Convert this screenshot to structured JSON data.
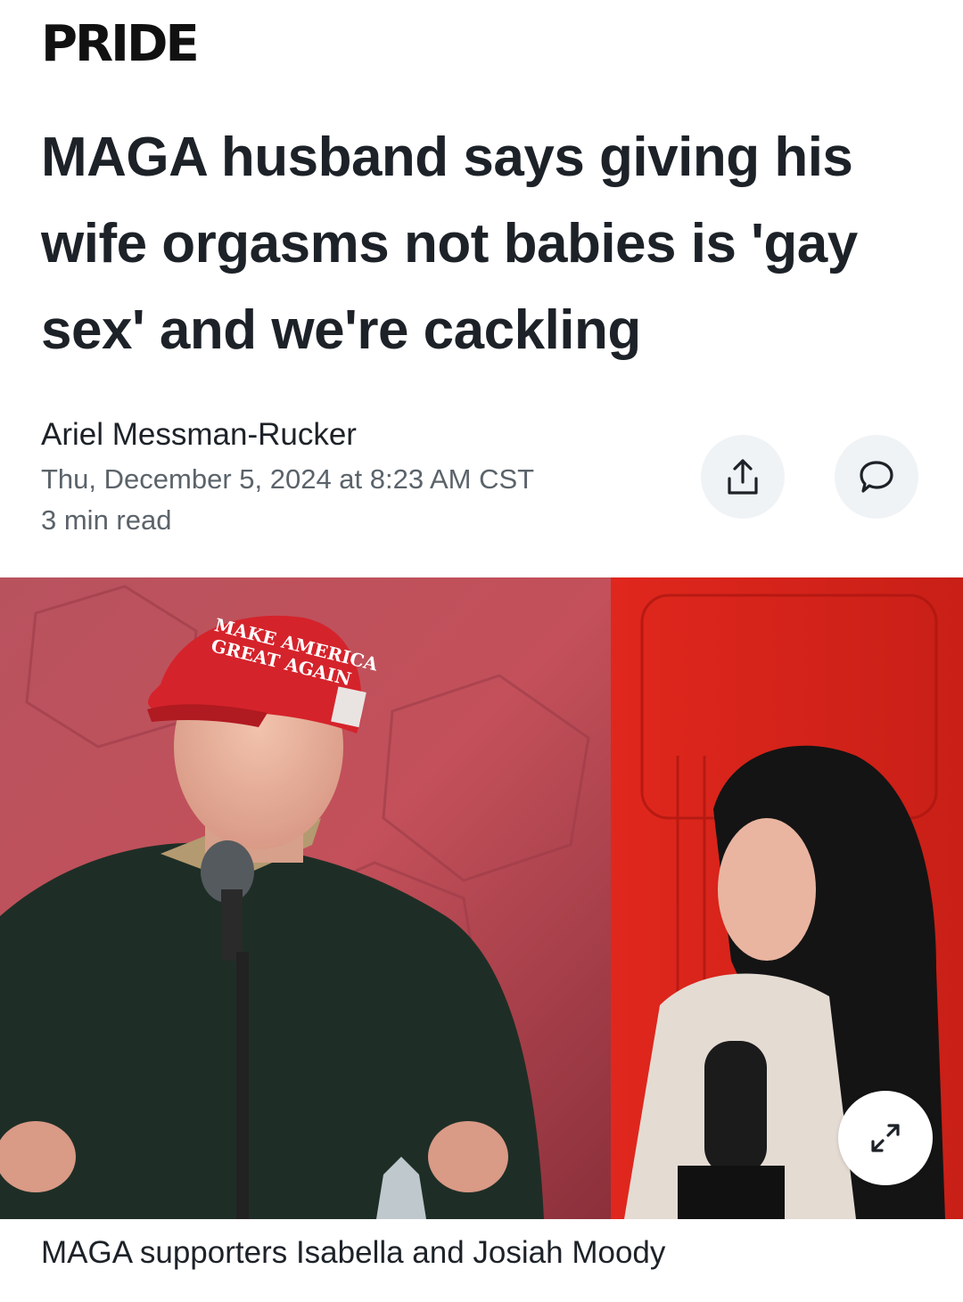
{
  "brand": {
    "name": "PRIDE"
  },
  "article": {
    "headline": "MAGA husband says giving his wife orgasms not babies is 'gay sex' and we're cackling",
    "author": "Ariel Messman-Rucker",
    "date": "Thu, December 5, 2024 at 8:23 AM CST",
    "read_time": "3 min read"
  },
  "actions": {
    "share_icon": "share-icon",
    "comment_icon": "comment-icon",
    "expand_icon": "expand-icon"
  },
  "hero_image": {
    "hat_text_line1": "MAKE AMERICA",
    "hat_text_line2": "GREAT AGAIN",
    "caption": "MAGA supporters Isabella and Josiah Moody"
  },
  "colors": {
    "text": "#1d2228",
    "meta": "#5b636a",
    "button_bg": "#f0f3f5",
    "hat_red": "#d5232b",
    "backdrop_red": "#e8231a"
  }
}
